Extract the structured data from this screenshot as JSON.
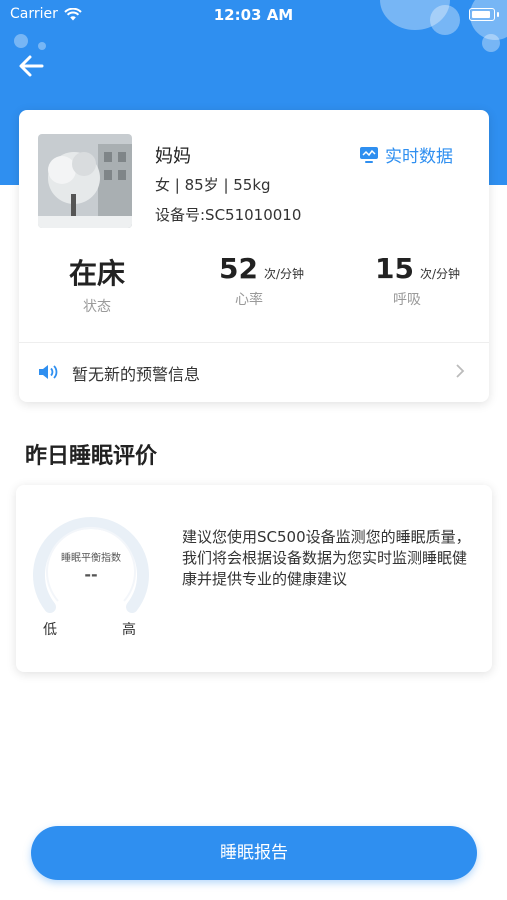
{
  "status_bar": {
    "carrier": "Carrier",
    "time": "12:03 AM"
  },
  "profile": {
    "name": "妈妈",
    "meta": "女 | 85岁 | 55kg",
    "device": "设备号:SC51010010",
    "realtime_label": "实时数据"
  },
  "stats": [
    {
      "value": "在床",
      "unit": "",
      "label": "状态"
    },
    {
      "value": "52",
      "unit": "次/分钟",
      "label": "心率"
    },
    {
      "value": "15",
      "unit": "次/分钟",
      "label": "呼吸"
    }
  ],
  "alert": {
    "text": "暂无新的预警信息"
  },
  "section": {
    "title": "昨日睡眠评价"
  },
  "sleep": {
    "gauge_label": "睡眠平衡指数",
    "gauge_value": "--",
    "low": "低",
    "high": "高",
    "advice": "建议您使用SC500设备监测您的睡眠质量，我们将会根据设备数据为您实时监测睡眠健康并提供专业的健康建议"
  },
  "report_button": {
    "label": "睡眠报告"
  },
  "colors": {
    "primary": "#2f8ff0"
  }
}
